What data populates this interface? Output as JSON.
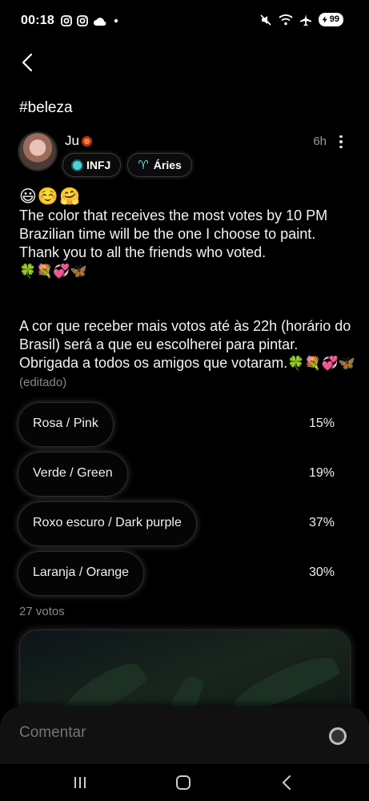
{
  "status_bar": {
    "time": "00:18",
    "battery": "99",
    "left_icons": [
      "instagram-icon",
      "instagram-icon",
      "cloud-icon",
      "dot-icon"
    ],
    "right_icons": [
      "mute-icon",
      "wifi-icon",
      "airplane-icon",
      "battery-icon"
    ]
  },
  "header": {
    "back_icon": "chevron-left-icon",
    "tag": "#beleza"
  },
  "post": {
    "author": "Ju",
    "time_ago": "6h",
    "chips": [
      {
        "label": "INFJ",
        "icon": "teal-dot-icon"
      },
      {
        "label": "Áries",
        "icon": "aries-icon",
        "symbol": "♈"
      }
    ],
    "emoji_line": "😃☺️🤗",
    "text_en": "The color that receives the most votes by 10 PM Brazilian time will be the one I choose to paint. Thank you to all the friends who voted.",
    "emojis_en": "🍀💐💞🦋",
    "text_pt": "A cor que receber mais votos até às 22h (horário do Brasil) será a que eu escolherei para pintar. Obrigada a todos os amigos que votaram.",
    "emojis_pt": "🍀💐💞🦋",
    "edited": "(editado)"
  },
  "poll": {
    "options": [
      {
        "label": "Rosa / Pink",
        "percent": "15%",
        "fraction": 0.15
      },
      {
        "label": "Verde / Green",
        "percent": "19%",
        "fraction": 0.19
      },
      {
        "label": "Roxo escuro / Dark purple",
        "percent": "37%",
        "fraction": 0.37
      },
      {
        "label": "Laranja / Orange",
        "percent": "30%",
        "fraction": 0.3
      }
    ],
    "votes": "27 votos"
  },
  "comment": {
    "placeholder": "Comentar"
  },
  "navbar": {
    "icons": [
      "recents-icon",
      "home-icon",
      "back-icon"
    ]
  }
}
